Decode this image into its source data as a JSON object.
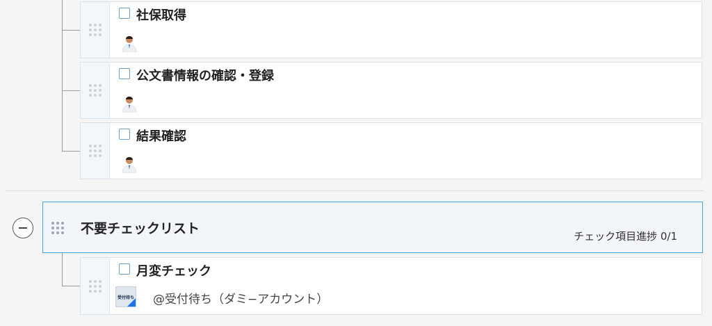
{
  "tasks": [
    {
      "title": "社保取得",
      "assignee": "person-avatar"
    },
    {
      "title": "公文書情報の確認・登録",
      "assignee": "person-avatar"
    },
    {
      "title": "結果確認",
      "assignee": "person-avatar"
    }
  ],
  "group": {
    "title": "不要チェックリスト",
    "progress": "チェック項目進捗 0/1",
    "expanded": true,
    "tasks": [
      {
        "title": "月変チェック",
        "assignee_label": "@受付待ち（ダミ−アカウント）",
        "assignee_thumb_text": "受付待ち"
      }
    ]
  },
  "colors": {
    "accent_border": "#4aa3df",
    "checkbox": "#6aa1c9",
    "thumb_corner": "#1a73e8"
  }
}
